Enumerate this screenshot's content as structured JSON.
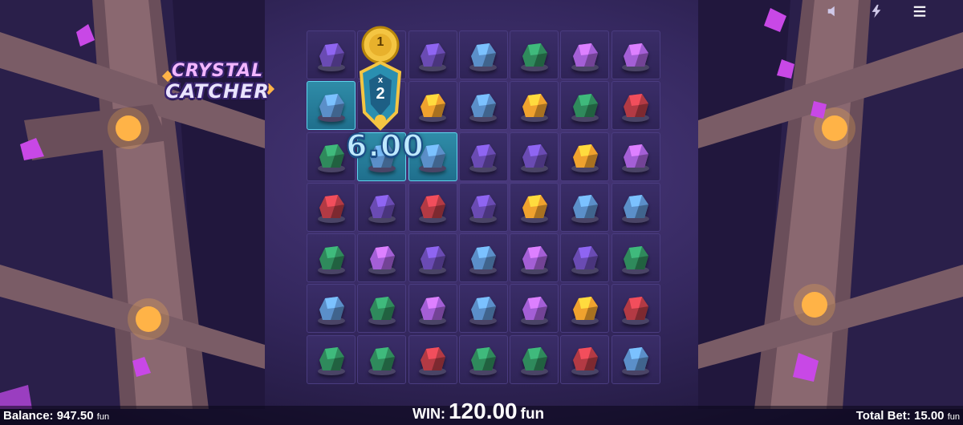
{
  "game": {
    "logo_line1": "CRYSTAL",
    "logo_line2": "CATCHER"
  },
  "top_icons": [
    "speaker-icon",
    "lightning-icon",
    "menu-icon"
  ],
  "grid": {
    "cols": 7,
    "rows": 7,
    "cells": [
      [
        "purple",
        "catcher",
        "purple",
        "blue",
        "green",
        "pink",
        "pink"
      ],
      [
        "blue",
        "catcher",
        "orange",
        "blue",
        "orange",
        "green",
        "red"
      ],
      [
        "green",
        "blue",
        "blue",
        "purple",
        "purple",
        "orange",
        "pink"
      ],
      [
        "red",
        "purple",
        "red",
        "purple",
        "orange",
        "blue",
        "blue"
      ],
      [
        "green",
        "pink",
        "purple",
        "blue",
        "pink",
        "purple",
        "green"
      ],
      [
        "blue",
        "green",
        "pink",
        "blue",
        "pink",
        "orange",
        "red"
      ],
      [
        "green",
        "green",
        "red",
        "green",
        "green",
        "red",
        "blue"
      ]
    ],
    "winning_cells": [
      [
        1,
        0
      ],
      [
        2,
        1
      ],
      [
        2,
        2
      ]
    ]
  },
  "catcher": {
    "top_label": "1",
    "multiplier_symbol": "x",
    "multiplier_value": "2"
  },
  "win_popup": "6.00",
  "footer": {
    "balance_label": "Balance:",
    "balance_value": "947.50",
    "balance_unit": "fun",
    "win_label": "WIN:",
    "win_value": "120.00",
    "win_unit": "fun",
    "totalbet_label": "Total Bet:",
    "totalbet_value": "15.00",
    "totalbet_unit": "fun"
  },
  "colors": {
    "purple": "#6a4bb3",
    "blue": "#5b8fc9",
    "green": "#2f8a5c",
    "pink": "#a45fd6",
    "orange": "#f0a22e",
    "red": "#b33a44",
    "accent_win": "#5fd3ee",
    "gold": "#f4c542"
  }
}
